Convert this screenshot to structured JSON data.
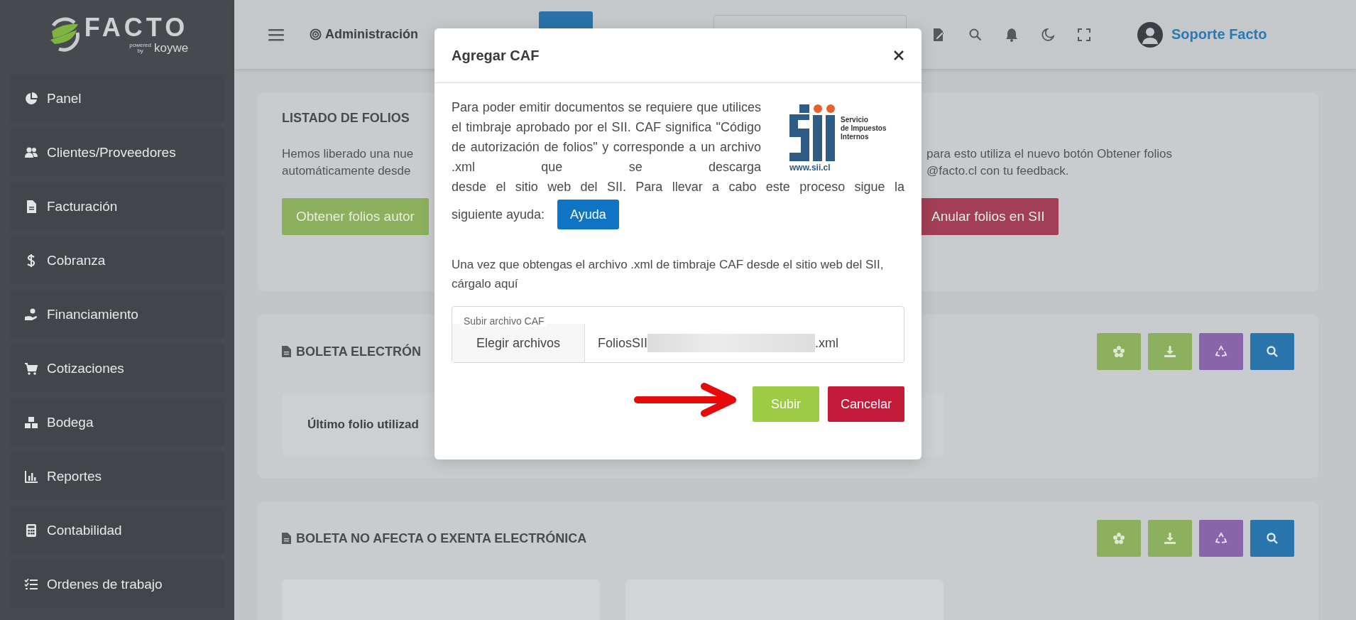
{
  "sidebar": {
    "logo": {
      "name": "FACTO",
      "powered": "powered",
      "by": "by",
      "brand": "koywe"
    },
    "items": [
      {
        "label": "Panel",
        "kind": "pie"
      },
      {
        "label": "Clientes/Proveedores",
        "kind": "users"
      },
      {
        "label": "Facturación",
        "kind": "file"
      },
      {
        "label": "Cobranza",
        "kind": "dollar"
      },
      {
        "label": "Financiamiento",
        "kind": "hand"
      },
      {
        "label": "Cotizaciones",
        "kind": "cart"
      },
      {
        "label": "Bodega",
        "kind": "boxes"
      },
      {
        "label": "Reportes",
        "kind": "chart"
      },
      {
        "label": "Contabilidad",
        "kind": "calculator"
      },
      {
        "label": "Ordenes de trabajo",
        "kind": "tasks"
      }
    ]
  },
  "header": {
    "breadcrumb": "Administración",
    "user": "Soporte Facto"
  },
  "folios_card": {
    "title": "LISTADO DE FOLIOS",
    "notice_left": [
      "Hemos liberado una nue",
      "automáticamente desde"
    ],
    "notice_right": [
      "para esto utiliza el nuevo botón Obtener folios",
      "@facto.cl con tu feedback."
    ],
    "buttons": [
      {
        "label": "Obtener folios autor",
        "kind": "success"
      },
      {
        "label": "Anular folios en SII",
        "kind": "danger"
      }
    ]
  },
  "sections": [
    {
      "title": "BOLETA ELECTRÓN",
      "stat_label": "Último folio utilizad",
      "actions": [
        {
          "kind": "settings"
        },
        {
          "kind": "download"
        },
        {
          "kind": "recycle"
        },
        {
          "kind": "search"
        }
      ]
    },
    {
      "title": "BOLETA NO AFECTA O EXENTA ELECTRÓNICA",
      "actions": [
        {
          "kind": "settings"
        },
        {
          "kind": "download"
        },
        {
          "kind": "recycle"
        },
        {
          "kind": "search"
        }
      ]
    }
  ],
  "modal": {
    "title": "Agregar CAF",
    "intro": [
      "Para poder emitir documentos se requiere que utilices el timbraje aprobado por el SII. CAF significa \"Código de autorización de folios\" y corresponde a un archivo .xml que se descarga",
      "desde el sitio web del SII. Para llevar a cabo este proceso sigue la"
    ],
    "intro_end": "siguiente ayuda:",
    "help_button": "Ayuda",
    "logo": {
      "lines": [
        "Servicio",
        "de Impuestos",
        "Internos"
      ],
      "url": "www.sii.cl"
    },
    "instruction": "Una vez que obtengas el archivo .xml de timbraje CAF desde el sitio web del SII, cárgalo aquí",
    "file_field": {
      "label": "Subir archivo CAF",
      "button": "Elegir archivos",
      "file_prefix": "FoliosSII",
      "file_suffix": ".xml"
    },
    "buttons": [
      {
        "label": "Subir",
        "kind": "primary"
      },
      {
        "label": "Cancelar",
        "kind": "danger"
      }
    ]
  }
}
